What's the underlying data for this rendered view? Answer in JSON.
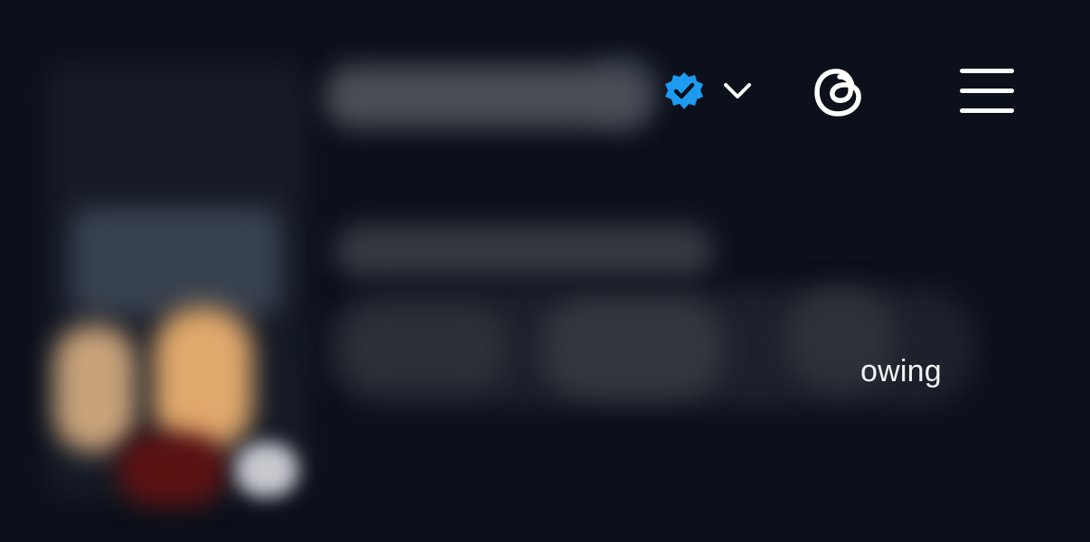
{
  "header": {
    "profile_name": "",
    "icons": {
      "verified": "verified-badge-icon",
      "dropdown": "chevron-down-icon",
      "app": "threads-logo-icon",
      "menu": "hamburger-menu-icon"
    },
    "colors": {
      "background": "#0c101a",
      "verified": "#1d9bf0",
      "icon": "#ffffff"
    }
  },
  "profile": {
    "following_label": "owing"
  }
}
